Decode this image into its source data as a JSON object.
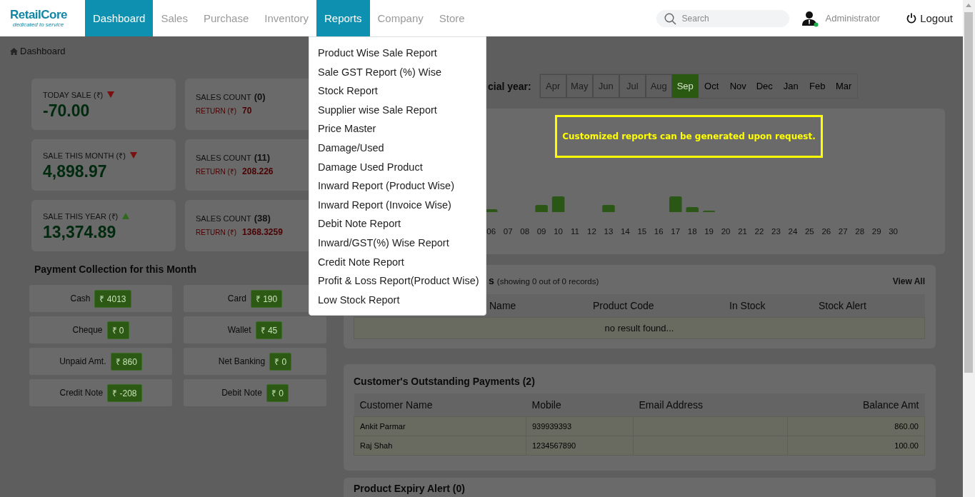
{
  "brand": {
    "name": "RetailCore",
    "tagline": "dedicated to service"
  },
  "nav": [
    {
      "label": "Dashboard",
      "selected": true
    },
    {
      "label": "Sales",
      "selected": false
    },
    {
      "label": "Purchase",
      "selected": false
    },
    {
      "label": "Inventory",
      "selected": false
    },
    {
      "label": "Reports",
      "selected": true
    },
    {
      "label": "Company",
      "selected": false
    },
    {
      "label": "Store",
      "selected": false
    }
  ],
  "search": {
    "placeholder": "Search"
  },
  "user": {
    "name": "Administrator",
    "online": true
  },
  "logout": "Logout",
  "breadcrumb": "Dashboard",
  "reports_menu": [
    "Product Wise Sale Report",
    "Sale GST Report (%) Wise",
    "Stock Report",
    "Supplier wise Sale Report",
    "Price Master",
    "Damage/Used",
    "Damage Used Product",
    "Inward Report (Product Wise)",
    "Inward Report (Invoice Wise)",
    "Debit Note Report",
    "Inward/GST(%) Wise Report",
    "Credit Note Report",
    "Profit & Loss Report(Product Wise)",
    "Low Stock Report"
  ],
  "stats": [
    {
      "label": "TODAY SALE (₹)",
      "kind": "down",
      "value": "-70.00",
      "count_label": "SALES COUNT",
      "count": "(0)",
      "return_label": "RETURN (₹)",
      "return_value": "70"
    },
    {
      "label": "SALE THIS MONTH (₹)",
      "kind": "down",
      "value": "4,898.97",
      "count_label": "SALES COUNT",
      "count": "(11)",
      "return_label": "RETURN (₹)",
      "return_value": "208.226"
    },
    {
      "label": "SALE THIS YEAR (₹)",
      "kind": "up",
      "value": "13,374.89",
      "count_label": "SALES COUNT",
      "count": "(38)",
      "return_label": "RETURN (₹)",
      "return_value": "1368.3259"
    }
  ],
  "payment_collection": {
    "title": "Payment Collection for this Month",
    "items": [
      {
        "label": "Cash",
        "amount": "₹ 4013"
      },
      {
        "label": "Card",
        "amount": "₹ 190"
      },
      {
        "label": "Cheque",
        "amount": "₹ 0"
      },
      {
        "label": "Wallet",
        "amount": "₹ 45"
      },
      {
        "label": "Unpaid Amt.",
        "amount": "₹ 860"
      },
      {
        "label": "Net Banking",
        "amount": "₹ 0"
      },
      {
        "label": "Credit Note",
        "amount": "₹ -208"
      },
      {
        "label": "Debit Note",
        "amount": "₹ 0"
      }
    ]
  },
  "month_selector": {
    "label": "cial year:",
    "months": [
      {
        "label": "Apr",
        "disabled": true,
        "selected": false
      },
      {
        "label": "May",
        "disabled": true,
        "selected": false
      },
      {
        "label": "Jun",
        "disabled": true,
        "selected": false
      },
      {
        "label": "Jul",
        "disabled": true,
        "selected": false
      },
      {
        "label": "Aug",
        "disabled": true,
        "selected": false
      },
      {
        "label": "Sep",
        "disabled": false,
        "selected": true
      },
      {
        "label": "Oct",
        "disabled": false,
        "selected": false
      },
      {
        "label": "Nov",
        "disabled": false,
        "selected": false
      },
      {
        "label": "Dec",
        "disabled": false,
        "selected": false
      },
      {
        "label": "Jan",
        "disabled": false,
        "selected": false
      },
      {
        "label": "Feb",
        "disabled": false,
        "selected": false
      },
      {
        "label": "Mar",
        "disabled": false,
        "selected": false
      }
    ]
  },
  "chart": {
    "day_labels": [
      "06",
      "07",
      "08",
      "09",
      "10",
      "11",
      "12",
      "13",
      "14",
      "15",
      "16",
      "17",
      "18",
      "19",
      "20",
      "21",
      "22",
      "23",
      "24",
      "25",
      "26",
      "27",
      "28",
      "29",
      "30"
    ]
  },
  "notice": "Customized reports can be generated upon request.",
  "low_stock": {
    "title": "s",
    "note": "(showing 0 out of 0 records)",
    "view_all": "View All",
    "columns": [
      "Name",
      "Product Code",
      "In Stock",
      "Stock Alert"
    ],
    "empty": "no result found..."
  },
  "outstanding": {
    "title": "Customer's Outstanding Payments (2)",
    "columns": [
      "Customer Name",
      "Mobile",
      "Email Address",
      "Balance Amt"
    ],
    "rows": [
      {
        "name": "Ankit Parmar",
        "mobile": "939939393",
        "balance": "860.00"
      },
      {
        "name": "Raj Shah",
        "mobile": "1234567890",
        "balance": "100.00"
      }
    ]
  },
  "expiry": {
    "title": "Product Expiry Alert (0)"
  }
}
